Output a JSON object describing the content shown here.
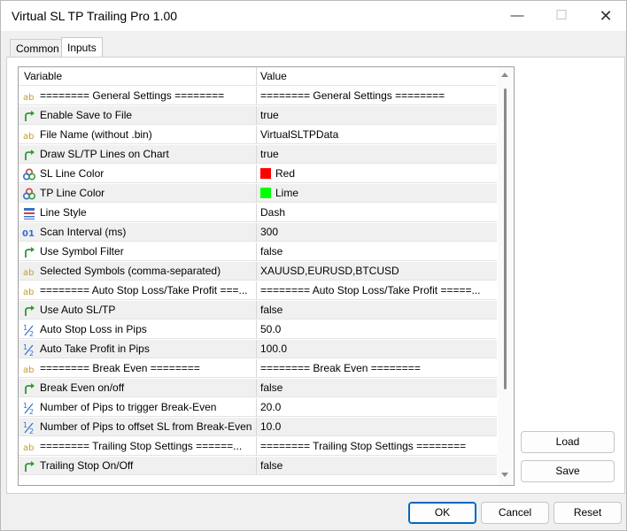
{
  "window": {
    "title": "Virtual SL TP Trailing Pro 1.00"
  },
  "tabs": [
    {
      "label": "Common"
    },
    {
      "label": "Inputs"
    }
  ],
  "grid": {
    "headers": {
      "variable": "Variable",
      "value": "Value"
    },
    "rows": [
      {
        "icon": "ab",
        "variable": "======== General Settings ========",
        "value": "======== General Settings ========"
      },
      {
        "icon": "arrow",
        "variable": "Enable Save to File",
        "value": "true"
      },
      {
        "icon": "ab",
        "variable": "File Name (without .bin)",
        "value": "VirtualSLTPData"
      },
      {
        "icon": "arrow",
        "variable": "Draw SL/TP Lines on Chart",
        "value": "true"
      },
      {
        "icon": "color",
        "variable": "SL Line Color",
        "value": "Red",
        "swatch": "#ff0000"
      },
      {
        "icon": "color",
        "variable": "TP Line Color",
        "value": "Lime",
        "swatch": "#00ff00"
      },
      {
        "icon": "style",
        "variable": "Line Style",
        "value": "Dash"
      },
      {
        "icon": "int",
        "variable": "Scan Interval (ms)",
        "value": "300"
      },
      {
        "icon": "arrow",
        "variable": "Use Symbol Filter",
        "value": "false"
      },
      {
        "icon": "ab",
        "variable": "Selected Symbols (comma-separated)",
        "value": "XAUUSD,EURUSD,BTCUSD"
      },
      {
        "icon": "ab",
        "variable": "======== Auto Stop Loss/Take Profit ===...",
        "value": "======== Auto Stop Loss/Take Profit =====..."
      },
      {
        "icon": "arrow",
        "variable": "Use Auto SL/TP",
        "value": "false"
      },
      {
        "icon": "half",
        "variable": "Auto Stop Loss in Pips",
        "value": "50.0"
      },
      {
        "icon": "half",
        "variable": "Auto Take Profit in Pips",
        "value": "100.0"
      },
      {
        "icon": "ab",
        "variable": "======== Break Even ========",
        "value": "======== Break Even ========"
      },
      {
        "icon": "arrow",
        "variable": "Break Even on/off",
        "value": "false"
      },
      {
        "icon": "half",
        "variable": "Number of Pips to trigger Break-Even",
        "value": "20.0"
      },
      {
        "icon": "half",
        "variable": "Number of Pips to offset SL from Break-Even",
        "value": "10.0"
      },
      {
        "icon": "ab",
        "variable": "======== Trailing Stop Settings ======...",
        "value": "======== Trailing Stop Settings ========"
      },
      {
        "icon": "arrow",
        "variable": "Trailing Stop On/Off",
        "value": "false"
      }
    ]
  },
  "side_buttons": {
    "load": "Load",
    "save": "Save"
  },
  "footer_buttons": {
    "ok": "OK",
    "cancel": "Cancel",
    "reset": "Reset"
  }
}
